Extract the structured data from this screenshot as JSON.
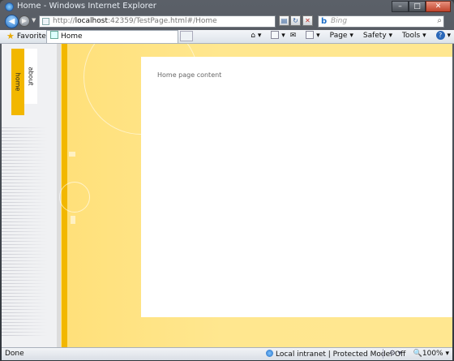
{
  "window": {
    "title": "Home - Windows Internet Explorer"
  },
  "address_bar": {
    "url_prefix": "http://",
    "url_host": "localhost",
    "url_rest": ":42359/TestPage.html#/Home"
  },
  "search": {
    "engine": "bing",
    "placeholder": "Bing"
  },
  "command_bar": {
    "favorites_label": "Favorites",
    "tab_label": "Home",
    "page_label": "Page",
    "safety_label": "Safety",
    "tools_label": "Tools",
    "help_glyph": "?"
  },
  "side_nav": {
    "items": [
      {
        "label": "home",
        "selected": true
      },
      {
        "label": "about",
        "selected": false
      }
    ]
  },
  "main": {
    "content_text": "Home page content"
  },
  "status": {
    "text": "Done",
    "zone": "Local intranet | Protected Mode: Off",
    "zoom": "100%"
  },
  "colors": {
    "accent": "#f2b700",
    "page_bg": "#ffe48c",
    "chrome": "#3a3f45"
  }
}
